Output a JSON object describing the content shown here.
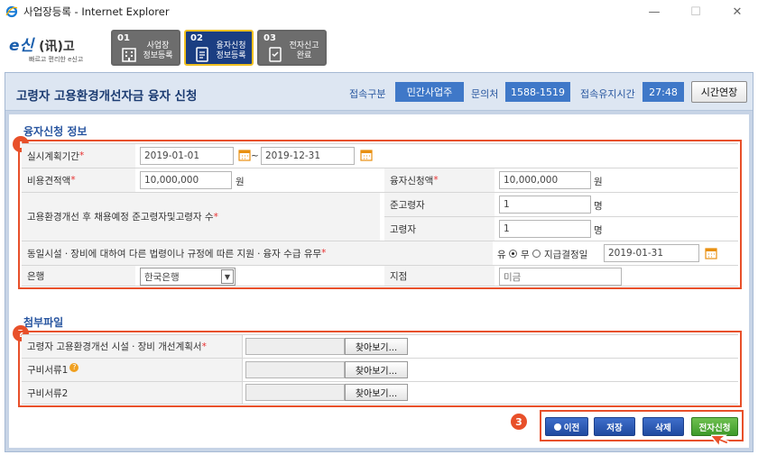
{
  "window": {
    "title": "사업장등록 - Internet Explorer",
    "minimize": "—",
    "maximize": "☐",
    "close": "✕"
  },
  "logo": {
    "main": "e신",
    "sub_mark": "(讯)고",
    "tagline": "빠르고 편리한 e신고"
  },
  "steps": [
    {
      "num": "01",
      "label": "사업장\n정보등록",
      "active": false
    },
    {
      "num": "02",
      "label": "융자신청\n정보등록",
      "active": true
    },
    {
      "num": "03",
      "label": "전자신고\n완료",
      "active": false
    }
  ],
  "topbar": {
    "page_title": "고령자 고용환경개선자금 융자 신청",
    "conn_type_label": "접속구분",
    "conn_type_value": "민간사업주",
    "contact_label": "문의처",
    "contact_value": "1588-1519",
    "time_label": "접속유지시간",
    "time_value": "27:48",
    "extend_button": "시간연장"
  },
  "section1": {
    "title": "융자신청 정보",
    "badge": "1",
    "period_label": "실시계획기간",
    "period_start": "2019-01-01",
    "period_sep": "~",
    "period_end": "2019-12-31",
    "cost_label": "비용견적액",
    "cost_value": "10,000,000",
    "cost_unit": "원",
    "loan_label": "융자신청액",
    "loan_value": "10,000,000",
    "loan_unit": "원",
    "hire_label": "고용환경개선 후 채용예정 준고령자및고령자 수",
    "semi_elder_label": "준고령자",
    "semi_elder_value": "1",
    "semi_elder_unit": "명",
    "elder_label": "고령자",
    "elder_value": "1",
    "elder_unit": "명",
    "support_label": "동일시설ㆍ장비에 대하여 다른 법령이나 규정에 따른 지원ㆍ융자 수급 유무",
    "support_yes": "유",
    "support_no": "무",
    "support_selected": "yes",
    "decision_date_label": "지급결정일",
    "decision_date": "2019-01-31",
    "bank_label": "은행",
    "bank_value": "한국은행",
    "branch_label": "지점",
    "branch_placeholder": "미금",
    "required_mark": "*"
  },
  "section2": {
    "title": "첨부파일",
    "badge": "2",
    "files": [
      {
        "label": "고령자 고용환경개선 시설ㆍ장비 개선계획서",
        "required": true,
        "help": false,
        "button": "찾아보기..."
      },
      {
        "label": "구비서류1",
        "required": false,
        "help": true,
        "button": "찾아보기..."
      },
      {
        "label": "구비서류2",
        "required": false,
        "help": false,
        "button": "찾아보기..."
      }
    ]
  },
  "actions": {
    "badge": "3",
    "prev": "이전",
    "save": "저장",
    "delete": "삭제",
    "submit": "전자신청"
  },
  "colors": {
    "accent": "#e8502a",
    "primary": "#3f78c8",
    "title": "#1c3c72",
    "submit": "#4fa83a"
  }
}
